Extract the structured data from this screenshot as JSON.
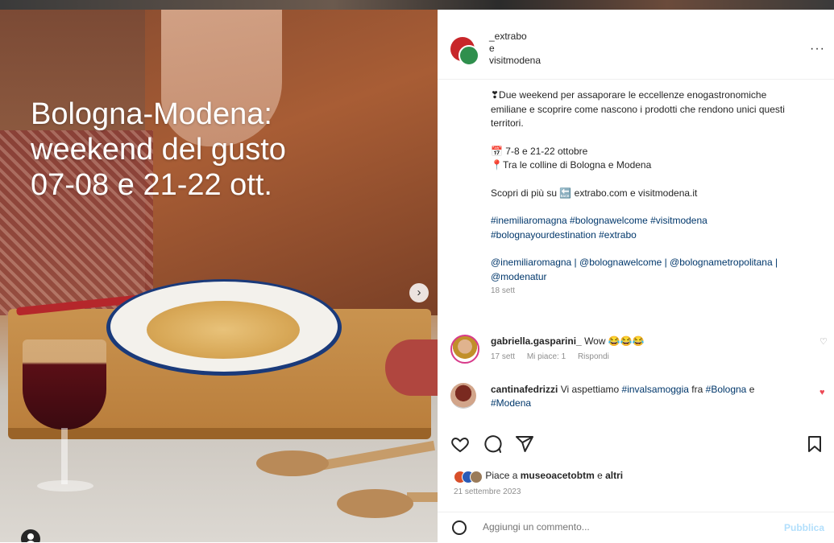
{
  "post": {
    "overlay_title": [
      "Bologna-Modena:",
      "weekend del gusto",
      "07-08 e 21-22 ott."
    ]
  },
  "header": {
    "account1": "_extrabo",
    "connector": "e",
    "account2": "visitmodena",
    "more": "···"
  },
  "caption": {
    "intro": "❣Due weekend per assaporare le eccellenze enogastronomiche emiliane e scoprire come nascono i prodotti che rendono unici questi territori.",
    "dates": "📅 7-8 e 21-22 ottobre",
    "place": "📍Tra le colline di Bologna e Modena",
    "more": "Scopri di più su 🔙 extrabo.com e visitmodena.it",
    "hashtags": "#inemiliaromagna #bolognawelcome #visitmodena #bolognayourdestination #extrabo",
    "mentions": "@inemiliaromagna | @bolognawelcome | @bolognametropolitana | @modenatur",
    "age": "18 sett"
  },
  "comments": [
    {
      "user": "gabriella.gasparini_",
      "text": "Wow 😂😂😂",
      "age": "17 sett",
      "likes": "Mi piace: 1",
      "reply": "Rispondi"
    },
    {
      "user": "cantinafedrizzi",
      "text": "Vi aspettiamo",
      "tag1": "#invalsamoggia",
      "mid": "fra",
      "tag2": "#Bologna",
      "conn": "e",
      "tag3": "#Modena"
    }
  ],
  "likes": {
    "prefix": "Piace a",
    "user": "museoacetobtm",
    "conn": "e",
    "others": "altri"
  },
  "date": "21 settembre 2023",
  "add_comment": {
    "placeholder": "Aggiungi un commento...",
    "publish": "Pubblica"
  },
  "icons": [
    "chevron-right-icon",
    "user-tag-icon",
    "heart-icon",
    "comment-icon",
    "share-icon",
    "bookmark-icon",
    "emoji-icon"
  ],
  "colors": {
    "hashtag": "#00376b",
    "heart_liked": "#ed4956",
    "publish_disabled": "#b2dffc"
  }
}
